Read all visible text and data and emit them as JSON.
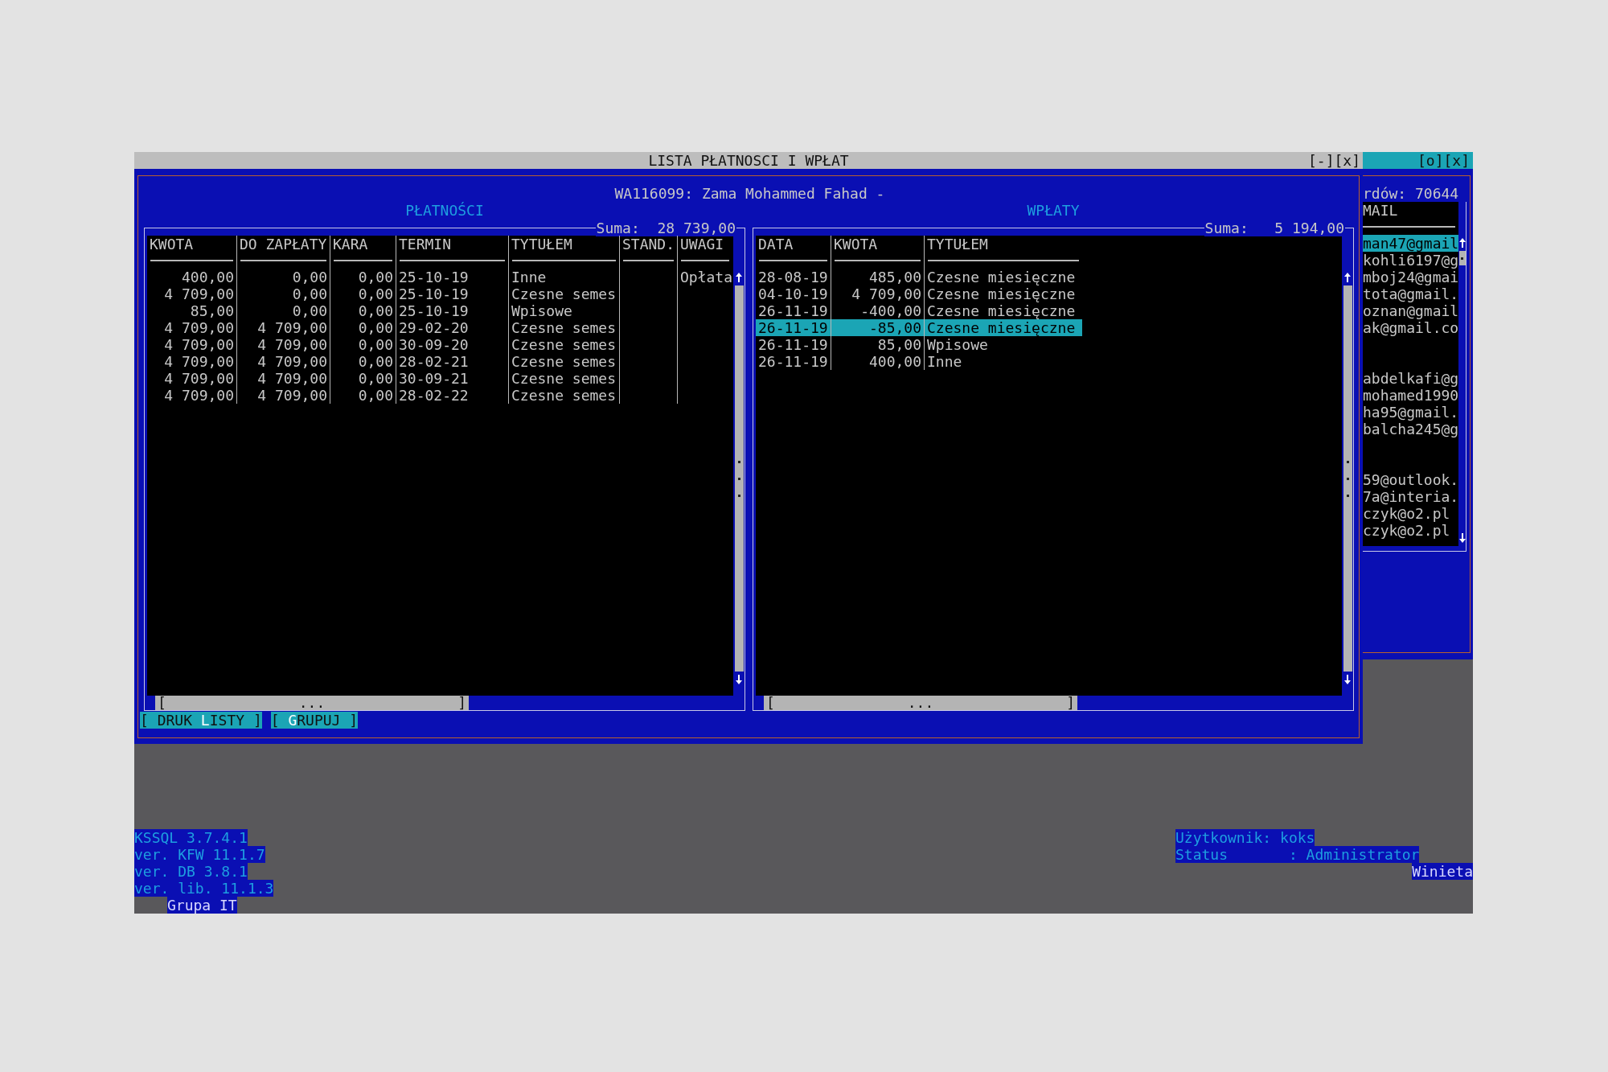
{
  "title_bar": {
    "title": "LISTA PŁATNOSCI I WPŁAT",
    "controls": [
      "[-]",
      "[x]"
    ]
  },
  "side_title_bar": {
    "controls": [
      "[o]",
      "[x]"
    ]
  },
  "main_window": {
    "header": "WA116099: Zama Mohammed Fahad -",
    "panels": [
      {
        "title": "PŁATNOŚCI",
        "sum": "Suma:  28 739,00",
        "columns": [
          {
            "label": "KWOTA",
            "kind": "amount"
          },
          {
            "label": "DO ZAPŁATY",
            "kind": "amount"
          },
          {
            "label": "KARA",
            "kind": "amount"
          },
          {
            "label": "TERMIN",
            "kind": "text"
          },
          {
            "label": "TYTUŁEM",
            "kind": "text"
          },
          {
            "label": "STAND.",
            "kind": "text"
          },
          {
            "label": "UWAGI",
            "kind": "text"
          }
        ],
        "rows": [
          {
            "selected": false,
            "cells": [
              "400,00",
              "0,00",
              "0,00",
              "25-10-19",
              "Inne",
              null,
              "Opłata"
            ]
          },
          {
            "selected": false,
            "cells": [
              "4 709,00",
              "0,00",
              "0,00",
              "25-10-19",
              "Czesne semes",
              null,
              null
            ]
          },
          {
            "selected": false,
            "cells": [
              "85,00",
              "0,00",
              "0,00",
              "25-10-19",
              "Wpisowe",
              null,
              null
            ]
          },
          {
            "selected": false,
            "cells": [
              "4 709,00",
              "4 709,00",
              "0,00",
              "29-02-20",
              "Czesne semes",
              null,
              null
            ]
          },
          {
            "selected": false,
            "cells": [
              "4 709,00",
              "4 709,00",
              "0,00",
              "30-09-20",
              "Czesne semes",
              null,
              null
            ]
          },
          {
            "selected": false,
            "cells": [
              "4 709,00",
              "4 709,00",
              "0,00",
              "28-02-21",
              "Czesne semes",
              null,
              null
            ]
          },
          {
            "selected": false,
            "cells": [
              "4 709,00",
              "4 709,00",
              "0,00",
              "30-09-21",
              "Czesne semes",
              null,
              null
            ]
          },
          {
            "selected": false,
            "cells": [
              "4 709,00",
              "4 709,00",
              "0,00",
              "28-02-22",
              "Czesne semes",
              null,
              null
            ]
          }
        ],
        "hscroll": {
          "left": "[",
          "middle": "...",
          "right": "]"
        }
      },
      {
        "title": "WPŁATY",
        "sum": "Suma:   5 194,00",
        "columns": [
          {
            "label": "DATA",
            "kind": "text"
          },
          {
            "label": "KWOTA",
            "kind": "amount"
          },
          {
            "label": "TYTUŁEM",
            "kind": "text"
          }
        ],
        "rows": [
          {
            "selected": false,
            "cells": [
              "28-08-19",
              "485,00",
              "Czesne miesięczne"
            ]
          },
          {
            "selected": false,
            "cells": [
              "04-10-19",
              "4 709,00",
              "Czesne miesięczne"
            ]
          },
          {
            "selected": false,
            "cells": [
              "26-11-19",
              "-400,00",
              "Czesne miesięczne"
            ]
          },
          {
            "selected": true,
            "cells": [
              "26-11-19",
              "-85,00",
              "Czesne miesięczne"
            ]
          },
          {
            "selected": false,
            "cells": [
              "26-11-19",
              "85,00",
              "Wpisowe"
            ]
          },
          {
            "selected": false,
            "cells": [
              "26-11-19",
              "400,00",
              "Inne"
            ]
          }
        ],
        "hscroll": {
          "left": "[",
          "middle": "...",
          "right": "]"
        }
      }
    ],
    "buttons": [
      {
        "label": "[ DRUK **L**ISTY ]"
      },
      {
        "label": "[ **G**RUPUJ ]"
      }
    ]
  },
  "side_window": {
    "counter": "rdów: 70644",
    "column": "MAIL",
    "email_groups": [
      [
        {
          "text": "man47@gmail",
          "selected": true
        },
        {
          "text": "kohli6197@g",
          "selected": false
        },
        {
          "text": "mboj24@gmai",
          "selected": false
        },
        {
          "text": "tota@gmail.",
          "selected": false
        },
        {
          "text": "oznan@gmail",
          "selected": false
        },
        {
          "text": "ak@gmail.co",
          "selected": false
        }
      ],
      [
        {
          "text": "abdelkafi@g",
          "selected": false
        },
        {
          "text": "mohamed1990",
          "selected": false
        },
        {
          "text": "ha95@gmail.",
          "selected": false
        },
        {
          "text": "balcha245@g",
          "selected": false
        }
      ],
      [
        {
          "text": "59@outlook.",
          "selected": false
        },
        {
          "text": "7a@interia.",
          "selected": false
        },
        {
          "text": "czyk@o2.pl",
          "selected": false
        },
        {
          "text": "czyk@o2.pl",
          "selected": false
        }
      ]
    ]
  },
  "footer": {
    "versions": [
      "KSSQL 3.7.4.1",
      "ver. KFW 11.1.7",
      "ver. DB 3.8.1",
      "ver. lib. 11.1.3"
    ],
    "group": "Grupa IT",
    "user": "Użytkownik: koks",
    "status": "Status       : Administrator",
    "vignette": "Winieta"
  }
}
